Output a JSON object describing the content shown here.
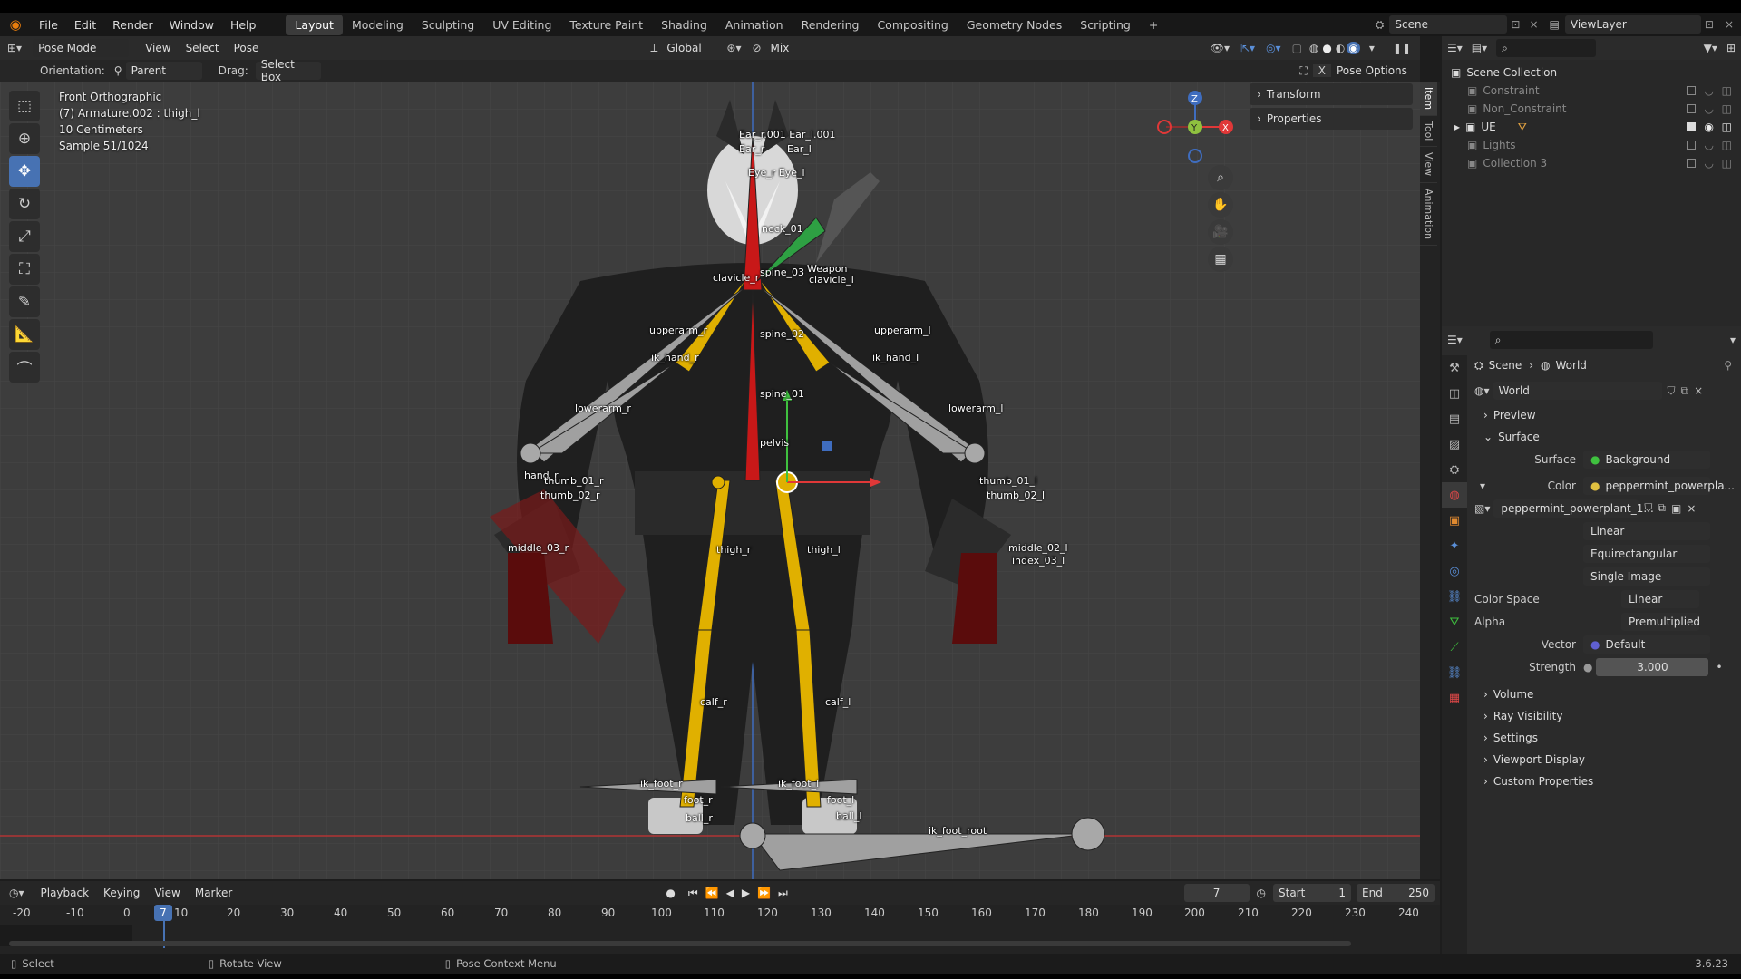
{
  "menu": [
    "File",
    "Edit",
    "Render",
    "Window",
    "Help"
  ],
  "workspaces": [
    "Layout",
    "Modeling",
    "Sculpting",
    "UV Editing",
    "Texture Paint",
    "Shading",
    "Animation",
    "Rendering",
    "Compositing",
    "Geometry Nodes",
    "Scripting"
  ],
  "active_workspace": "Layout",
  "scene_name": "Scene",
  "view_layer": "ViewLayer",
  "viewport_header": {
    "mode": "Pose Mode",
    "menus": [
      "View",
      "Select",
      "Pose"
    ],
    "transform_orientation": "Global",
    "mix": "Mix"
  },
  "tool_settings": {
    "orientation_label": "Orientation:",
    "orientation_value": "Parent",
    "drag_label": "Drag:",
    "drag_value": "Select Box",
    "pose_options": "Pose Options"
  },
  "viewport_overlay": {
    "view": "Front Orthographic",
    "object": "(7) Armature.002 : thigh_l",
    "scale": "10 Centimeters",
    "sample": "Sample 51/1024"
  },
  "npanel": {
    "items": [
      "Transform",
      "Properties"
    ],
    "tabs": [
      "Item",
      "Tool",
      "View",
      "Animation"
    ]
  },
  "gizmo": {
    "z": "Z",
    "y": "Y",
    "x": "X"
  },
  "bone_labels": [
    {
      "text": "Ear_r.001 Ear_l.001"
    },
    {
      "text": "Ear_r"
    },
    {
      "text": "Ear_l"
    },
    {
      "text": "Eye_r Eye_l"
    },
    {
      "text": "neck_01"
    },
    {
      "text": "spine_03"
    },
    {
      "text": "Weapon"
    },
    {
      "text": "clavicle_r"
    },
    {
      "text": "clavicle_l"
    },
    {
      "text": "upperarm_r"
    },
    {
      "text": "spine_02"
    },
    {
      "text": "upperarm_l"
    },
    {
      "text": "ik_hand_r"
    },
    {
      "text": "ik_hand_l"
    },
    {
      "text": "spine_01"
    },
    {
      "text": "lowerarm_r"
    },
    {
      "text": "lowerarm_l"
    },
    {
      "text": "pelvis"
    },
    {
      "text": "hand_r"
    },
    {
      "text": "thumb_01_r"
    },
    {
      "text": "thumb_02_r"
    },
    {
      "text": "thumb_01_l"
    },
    {
      "text": "thumb_02_l"
    },
    {
      "text": "thigh_r"
    },
    {
      "text": "thigh_l"
    },
    {
      "text": "calf_r"
    },
    {
      "text": "calf_l"
    },
    {
      "text": "ik_foot_r"
    },
    {
      "text": "ik_foot_l"
    },
    {
      "text": "foot_r"
    },
    {
      "text": "foot_l"
    },
    {
      "text": "ball_r"
    },
    {
      "text": "ball_l"
    },
    {
      "text": "ik_foot_root"
    },
    {
      "text": "middle_03_r"
    },
    {
      "text": "middle_02_l"
    },
    {
      "text": "index_03_l"
    }
  ],
  "outliner": {
    "root": "Scene Collection",
    "items": [
      {
        "name": "Constraint",
        "checked": false
      },
      {
        "name": "Non_Constraint",
        "checked": false
      },
      {
        "name": "UE",
        "checked": true
      },
      {
        "name": "Lights",
        "checked": false
      },
      {
        "name": "Collection 3",
        "checked": false
      }
    ]
  },
  "properties": {
    "breadcrumb": [
      "Scene",
      "World"
    ],
    "world_name": "World",
    "sections_collapsed_top": [
      "Preview"
    ],
    "surface": {
      "title": "Surface",
      "surface_label": "Surface",
      "surface_value": "Background",
      "color_label": "Color",
      "color_value": "peppermint_powerpla...",
      "image_name": "peppermint_powerplant_1...",
      "interpolation": "Linear",
      "projection": "Equirectangular",
      "source": "Single Image",
      "color_space_label": "Color Space",
      "color_space": "Linear",
      "alpha_label": "Alpha",
      "alpha": "Premultiplied",
      "vector_label": "Vector",
      "vector": "Default",
      "strength_label": "Strength",
      "strength": "3.000"
    },
    "sections_bottom": [
      "Volume",
      "Ray Visibility",
      "Settings",
      "Viewport Display",
      "Custom Properties"
    ]
  },
  "timeline": {
    "menus": [
      "Playback",
      "Keying",
      "View",
      "Marker"
    ],
    "current_frame": "7",
    "start_label": "Start",
    "start": "1",
    "end_label": "End",
    "end": "250",
    "ticks": [
      "-20",
      "-10",
      "0",
      "10",
      "20",
      "30",
      "40",
      "50",
      "60",
      "70",
      "80",
      "90",
      "100",
      "110",
      "120",
      "130",
      "140",
      "150",
      "160",
      "170",
      "180",
      "190",
      "200",
      "210",
      "220",
      "230",
      "240"
    ]
  },
  "status": {
    "select": "Select",
    "rotate": "Rotate View",
    "context": "Pose Context Menu",
    "version": "3.6.23"
  },
  "colors": {
    "accent": "#4772b3",
    "bone_yellow": "#e0b000",
    "bone_red": "#c81818",
    "bone_gray": "#a0a0a0"
  }
}
